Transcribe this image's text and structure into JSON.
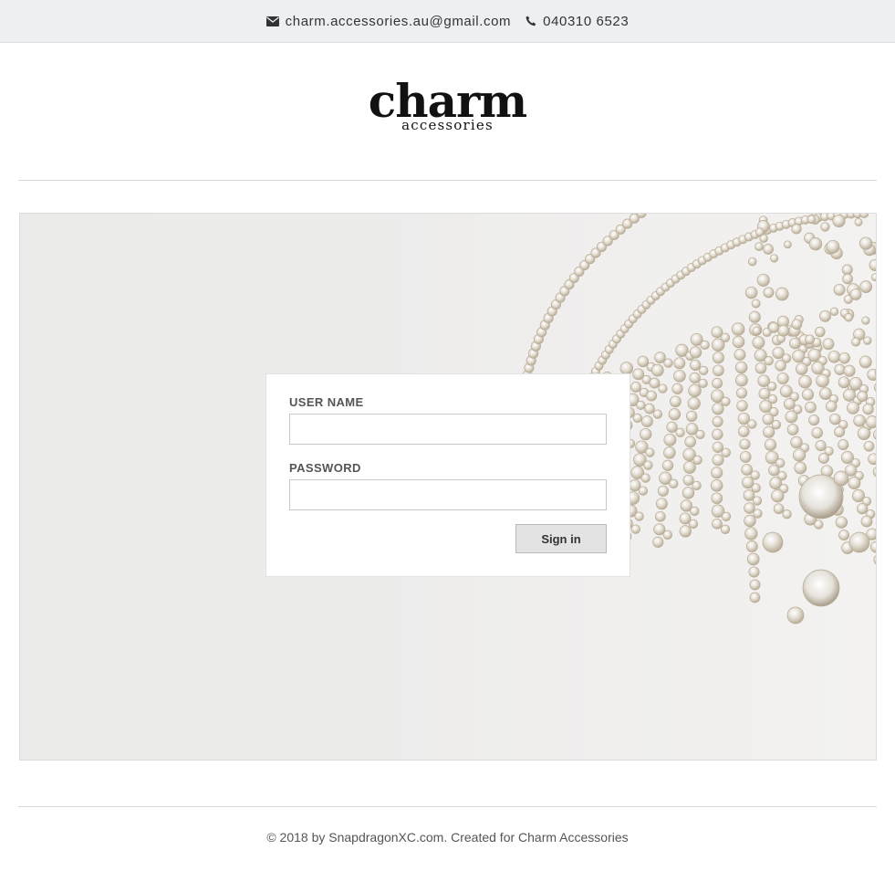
{
  "header": {
    "email": "charm.accessories.au@gmail.com",
    "email_icon": "envelope-icon",
    "phone": "040310 6523",
    "phone_icon": "phone-icon"
  },
  "logo": {
    "main": "charm",
    "sub": "accessories"
  },
  "hero": {
    "image": "crystal-jewelry-photo",
    "background_color": "#ecebea"
  },
  "login": {
    "username_label": "USER NAME",
    "username_value": "",
    "password_label": "PASSWORD",
    "password_value": "",
    "signin_label": "Sign in"
  },
  "footer": {
    "text": "© 2018 by SnapdragonXC.com. Created for Charm Accessories"
  }
}
